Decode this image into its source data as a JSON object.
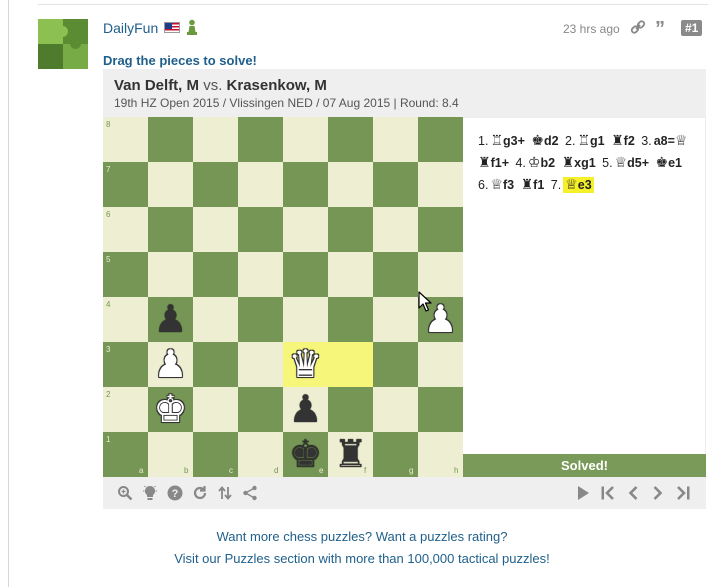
{
  "post": {
    "username": "DailyFun",
    "flag_icon": "us-flag-icon",
    "badge_icon": "pawn-badge-icon",
    "timestamp": "23 hrs ago",
    "post_number": "#1",
    "prompt": "Drag the pieces to solve!"
  },
  "game": {
    "white_player": "Van Delft, M",
    "vs": "vs.",
    "black_player": "Krasenkow, M",
    "event": "19th HZ Open 2015 / Vlissingen NED / 07 Aug 2015 | Round: 8.4"
  },
  "board": {
    "colors": {
      "light": "#eeeed2",
      "dark": "#769656",
      "highlight": "#f6f67a"
    },
    "ranks": [
      "8",
      "7",
      "6",
      "5",
      "4",
      "3",
      "2",
      "1"
    ],
    "files": [
      "a",
      "b",
      "c",
      "d",
      "e",
      "f",
      "g",
      "h"
    ],
    "highlighted_squares": [
      "e3",
      "f3"
    ],
    "pieces": [
      {
        "square": "b4",
        "piece": "pawn",
        "color": "black",
        "glyph": "♟"
      },
      {
        "square": "h4",
        "piece": "pawn",
        "color": "white",
        "glyph": "♟"
      },
      {
        "square": "b3",
        "piece": "pawn",
        "color": "white",
        "glyph": "♟"
      },
      {
        "square": "e3",
        "piece": "queen",
        "color": "white",
        "glyph": "♛"
      },
      {
        "square": "b2",
        "piece": "king",
        "color": "white",
        "glyph": "♚"
      },
      {
        "square": "e2",
        "piece": "pawn",
        "color": "black",
        "glyph": "♟"
      },
      {
        "square": "e1",
        "piece": "king",
        "color": "black",
        "glyph": "♚"
      },
      {
        "square": "f1",
        "piece": "rook",
        "color": "black",
        "glyph": "♜"
      }
    ]
  },
  "moves": {
    "list": [
      {
        "num": "1.",
        "white": "g3",
        "white_glyph": "♖",
        "white_suffix": "+",
        "black": "d2",
        "black_glyph": "♚"
      },
      {
        "num": "2.",
        "white": "g1",
        "white_glyph": "♖",
        "white_suffix": "",
        "black": "f2",
        "black_glyph": "♜"
      },
      {
        "num": "3.",
        "white": "a8=",
        "white_glyph": "",
        "white_suffix": "",
        "white_promo_glyph": "♕",
        "black": "f1",
        "black_glyph": "♜",
        "black_suffix": "+"
      },
      {
        "num": "4.",
        "white": "b2",
        "white_glyph": "♔",
        "white_suffix": "",
        "black": "xg1",
        "black_glyph": "♜"
      },
      {
        "num": "5.",
        "white": "d5",
        "white_glyph": "♕",
        "white_suffix": "+",
        "black": "e1",
        "black_glyph": "♚"
      },
      {
        "num": "6.",
        "white": "f3",
        "white_glyph": "♕",
        "white_suffix": "",
        "black": "f1",
        "black_glyph": "♜"
      },
      {
        "num": "7.",
        "white": "e3",
        "white_glyph": "♕",
        "white_suffix": "",
        "current": true
      }
    ],
    "status": "Solved!"
  },
  "toolbar": {
    "left_icons": [
      "analysis-icon",
      "hint-icon",
      "help-icon",
      "retry-icon",
      "flip-icon",
      "share-icon"
    ],
    "right_icons": [
      "play-icon",
      "first-move-icon",
      "previous-move-icon",
      "next-move-icon",
      "last-move-icon"
    ]
  },
  "footer": {
    "line1": "Want more chess puzzles? Want a puzzles rating?",
    "line2": "Visit our Puzzles section with more than 100,000 tactical puzzles!"
  }
}
